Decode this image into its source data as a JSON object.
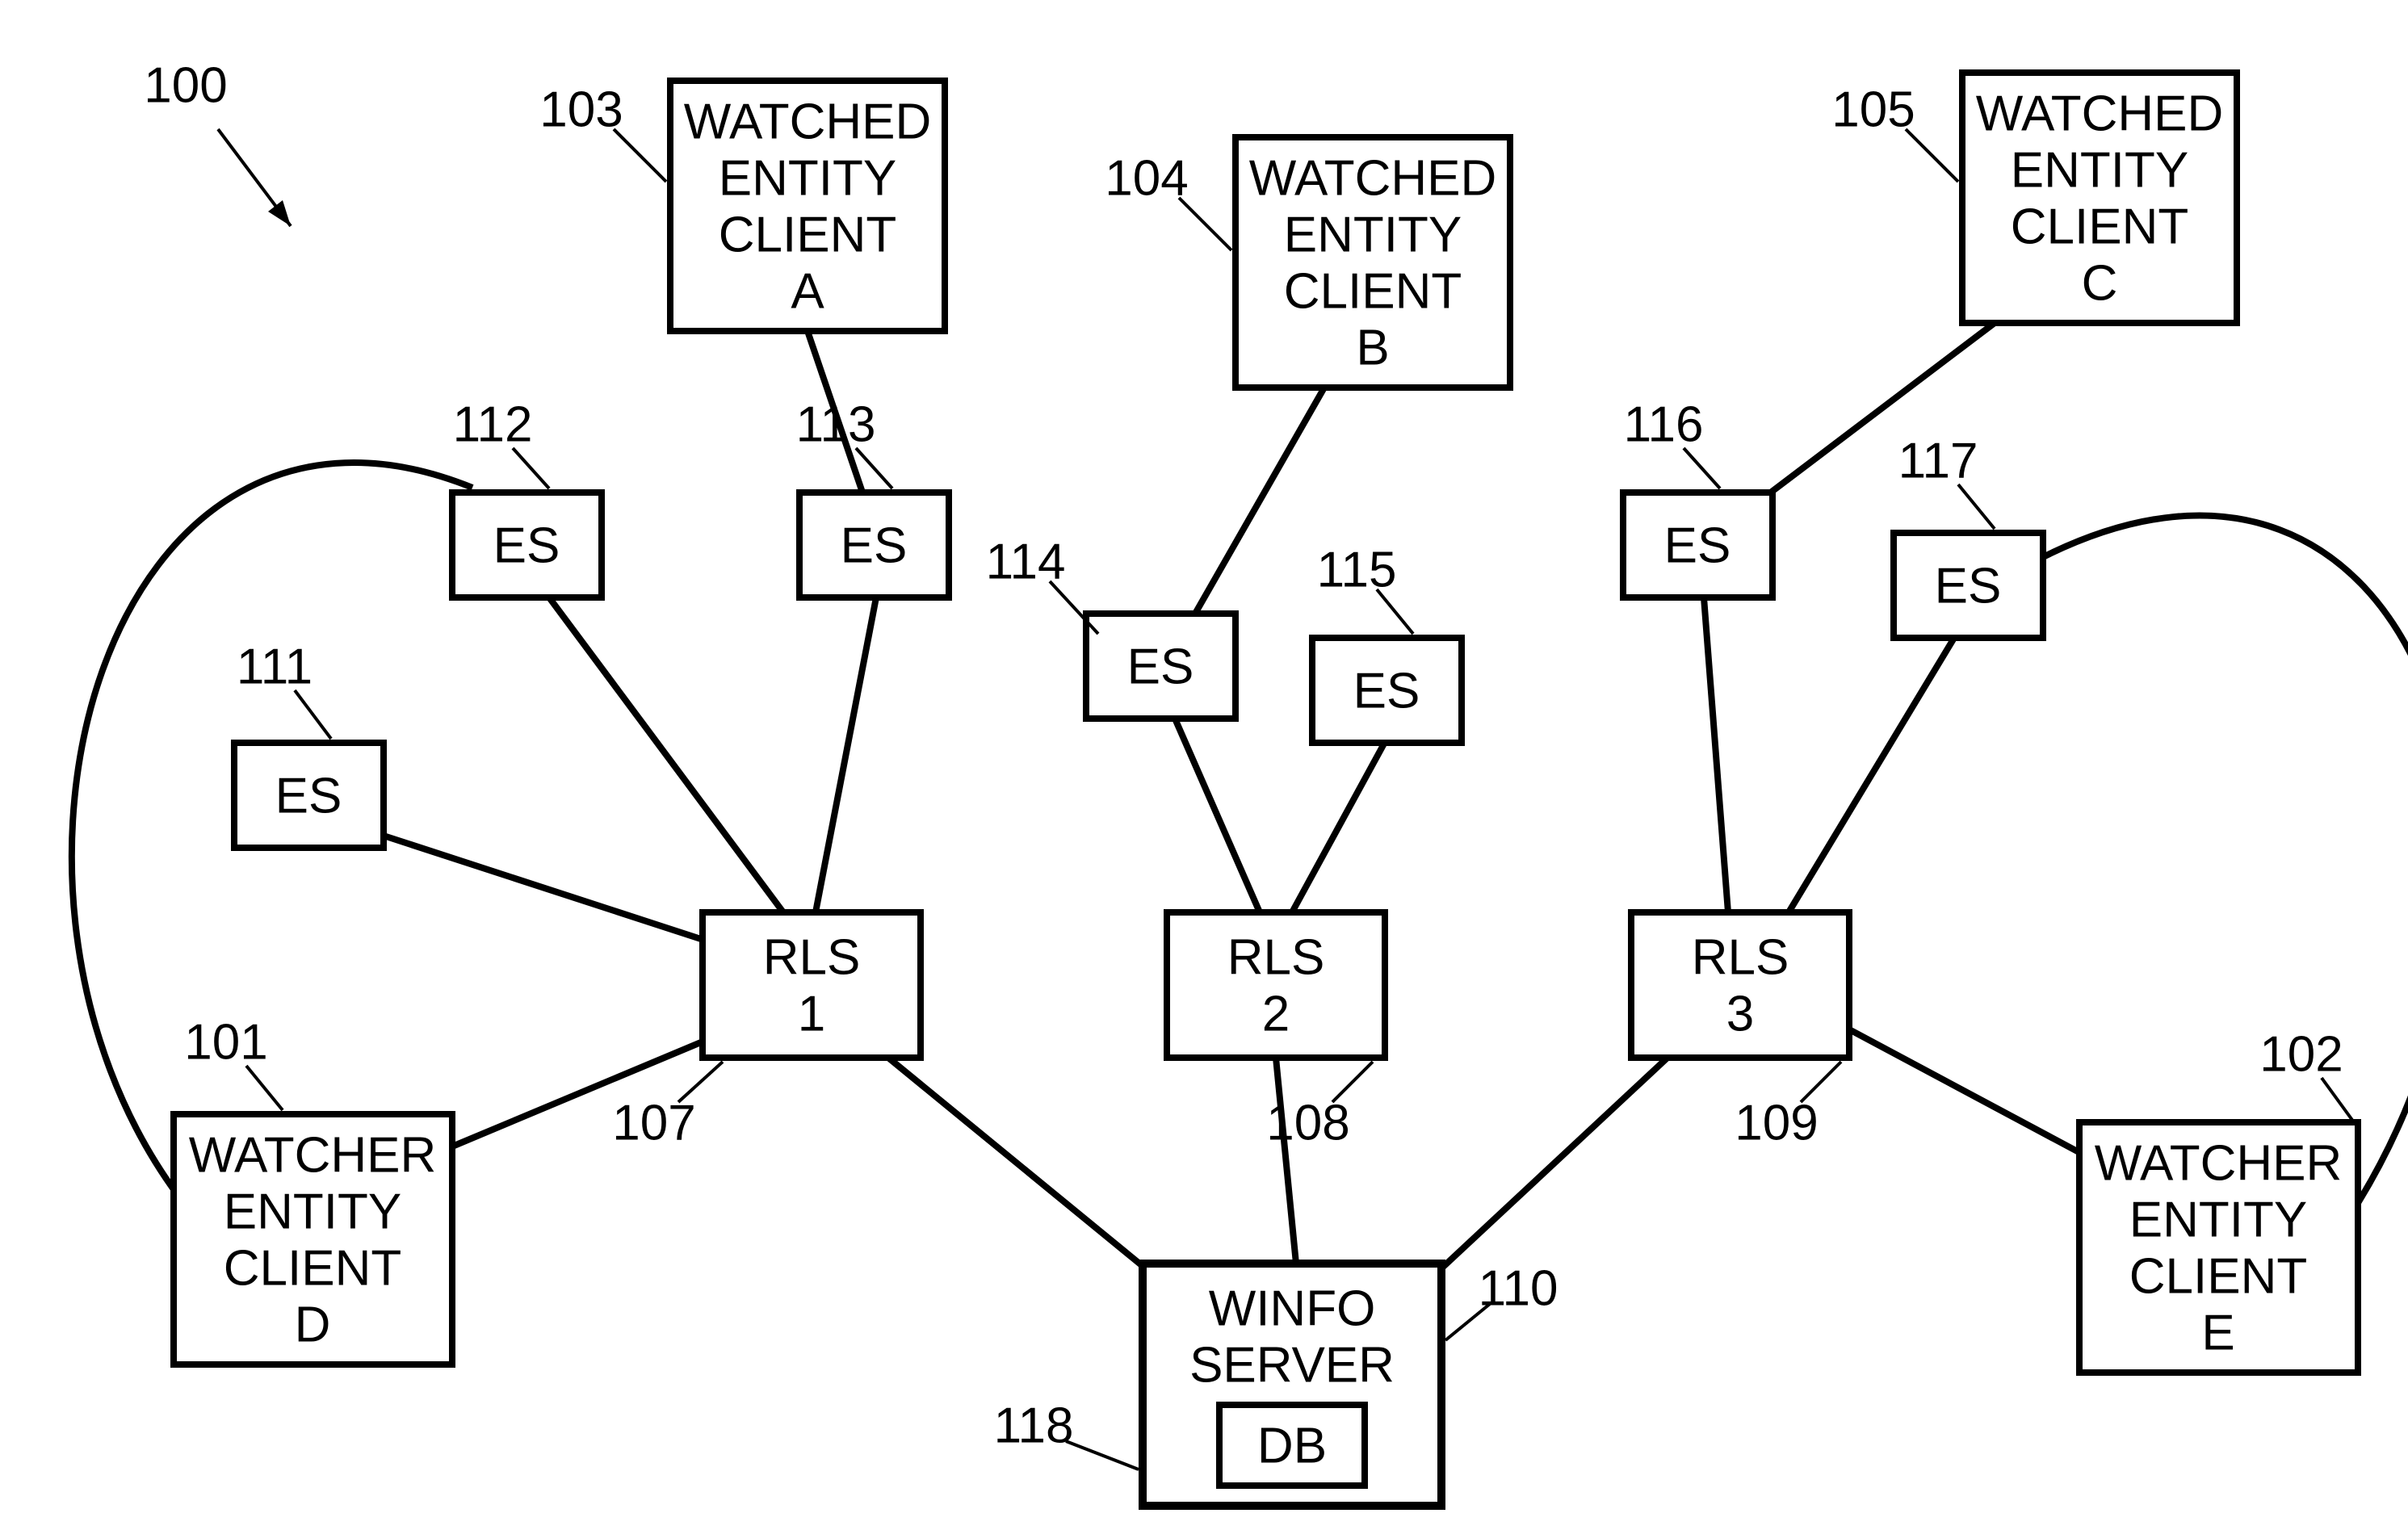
{
  "figureId": "100",
  "nodes": {
    "we_a": {
      "id": "103",
      "lines": [
        "WATCHED",
        "ENTITY",
        "CLIENT",
        "A"
      ]
    },
    "we_b": {
      "id": "104",
      "lines": [
        "WATCHED",
        "ENTITY",
        "CLIENT",
        "B"
      ]
    },
    "we_c": {
      "id": "105",
      "lines": [
        "WATCHED",
        "ENTITY",
        "CLIENT",
        "C"
      ]
    },
    "wr_d": {
      "id": "101",
      "lines": [
        "WATCHER",
        "ENTITY",
        "CLIENT",
        "D"
      ]
    },
    "wr_e": {
      "id": "102",
      "lines": [
        "WATCHER",
        "ENTITY",
        "CLIENT",
        "E"
      ]
    },
    "es111": {
      "id": "111",
      "label": "ES"
    },
    "es112": {
      "id": "112",
      "label": "ES"
    },
    "es113": {
      "id": "113",
      "label": "ES"
    },
    "es114": {
      "id": "114",
      "label": "ES"
    },
    "es115": {
      "id": "115",
      "label": "ES"
    },
    "es116": {
      "id": "116",
      "label": "ES"
    },
    "es117": {
      "id": "117",
      "label": "ES"
    },
    "rls1": {
      "id": "107",
      "lines": [
        "RLS",
        "1"
      ]
    },
    "rls2": {
      "id": "108",
      "lines": [
        "RLS",
        "2"
      ]
    },
    "rls3": {
      "id": "109",
      "lines": [
        "RLS",
        "3"
      ]
    },
    "winfo": {
      "id": "110",
      "lines": [
        "WINFO",
        "SERVER"
      ]
    },
    "db": {
      "id": "118",
      "label": "DB"
    }
  }
}
